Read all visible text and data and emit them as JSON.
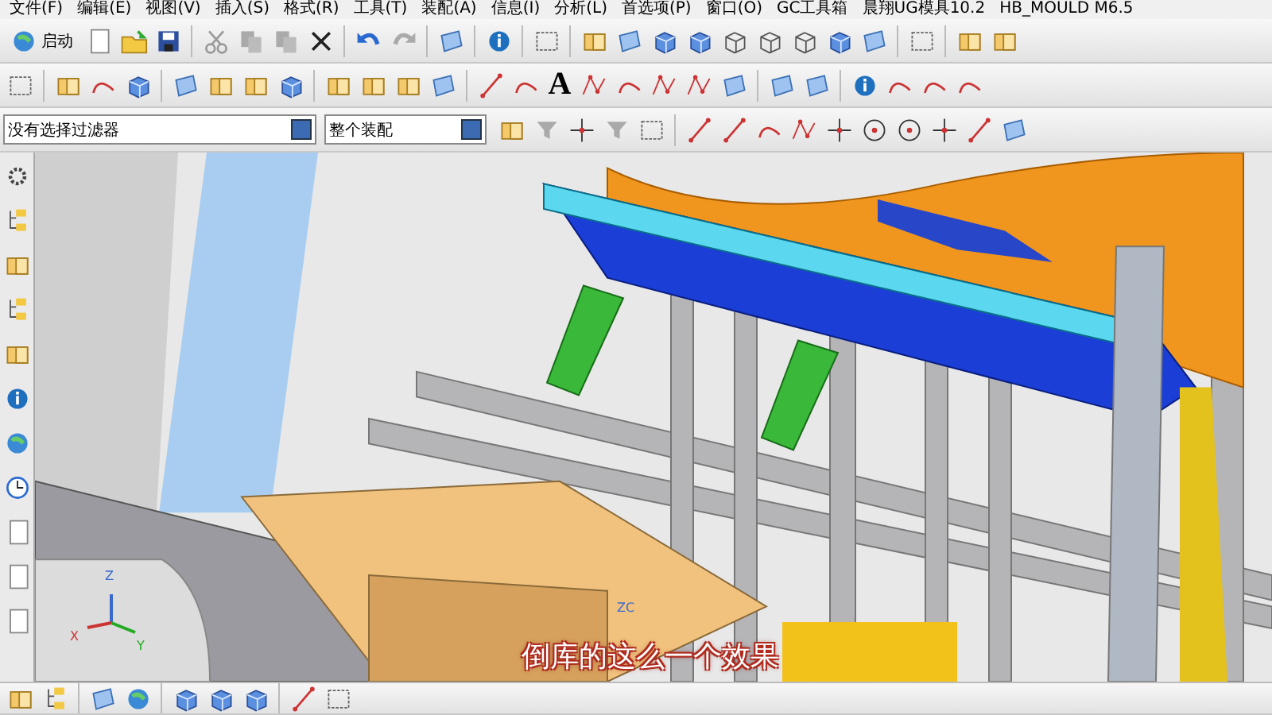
{
  "menu_bar": {
    "items": [
      "文件(F)",
      "编辑(E)",
      "视图(V)",
      "插入(S)",
      "格式(R)",
      "工具(T)",
      "装配(A)",
      "信息(I)",
      "分析(L)",
      "首选项(P)",
      "窗口(O)",
      "GC工具箱",
      "晨翔UG模具10.2",
      "HB_MOULD M6.5"
    ]
  },
  "standard_toolbar": {
    "start_button": "启动"
  },
  "curve_toolbar": {
    "text_tool": "A"
  },
  "selection_bar": {
    "filter": "没有选择过滤器",
    "scope": "整个装配"
  },
  "viewport": {
    "triad_labels": [
      "Z",
      "X",
      "Y"
    ],
    "wcs_label": "ZC",
    "subtitle": "倒库的这么一个效果"
  }
}
